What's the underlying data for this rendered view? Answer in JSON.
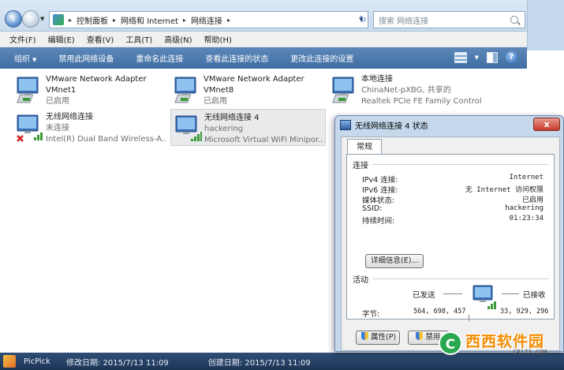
{
  "address": {
    "crumbs": [
      "控制面板",
      "网络和 Internet",
      "网络连接"
    ],
    "search_placeholder": "搜索 网络连接"
  },
  "menu": [
    "文件(F)",
    "编辑(E)",
    "查看(V)",
    "工具(T)",
    "高级(N)",
    "帮助(H)"
  ],
  "toolbar": {
    "organize": "组织",
    "items": [
      "禁用此网络设备",
      "重命名此连接",
      "查看此连接的状态",
      "更改此连接的设置"
    ]
  },
  "connections": [
    {
      "name": "VMware Network Adapter",
      "line2": "VMnet1",
      "line3": "已启用",
      "icon": "network-adapter-icon",
      "selected": false
    },
    {
      "name": "VMware Network Adapter",
      "line2": "VMnet8",
      "line3": "已启用",
      "icon": "network-adapter-icon",
      "selected": false
    },
    {
      "name": "本地连接",
      "line2": "ChinaNet-pXBG, 共享的",
      "line3": "Realtek PCIe FE Family Controll...",
      "icon": "network-adapter-icon",
      "selected": false
    },
    {
      "name": "无线网络连接",
      "line2": "未连接",
      "line3": "Intel(R) Dual Band Wireless-A...",
      "icon": "wireless-disconnected-icon",
      "selected": false
    },
    {
      "name": "无线网络连接 4",
      "line2": "hackering",
      "line3": "Microsoft Virtual WiFi Minipor...",
      "icon": "wireless-connected-icon",
      "selected": true
    }
  ],
  "dialog": {
    "title": "无线网络连接 4 状态",
    "close": "x",
    "tab": "常规",
    "connection_section": "连接",
    "rows": [
      {
        "label": "IPv4 连接:",
        "value": "Internet"
      },
      {
        "label": "IPv6 连接:",
        "value": "无 Internet 访问权限"
      },
      {
        "label": "媒体状态:",
        "value": "已启用"
      },
      {
        "label": "SSID:",
        "value": "hackering"
      },
      {
        "label": "持续时间:",
        "value": "01:23:34"
      }
    ],
    "details_button": "详细信息(E)...",
    "activity_section": "活动",
    "sent_label": "已发送",
    "received_label": "已接收",
    "bytes_label": "字节:",
    "bytes_sent": "564, 698, 457",
    "bytes_received": "33, 929, 296",
    "properties_button": "属性(P)",
    "disable_button": "禁用"
  },
  "status_strip": {
    "app": "PicPick",
    "modified": "修改日期: 2015/7/13 11:09",
    "created": "创建日期: 2015/7/13 11:09"
  },
  "watermark": {
    "text": "西西软件园",
    "sub": "CR173.COM"
  },
  "colors": {
    "toolbar": "#4a78ad",
    "selection": "#e8eaec",
    "close_button": "#c7392a"
  }
}
